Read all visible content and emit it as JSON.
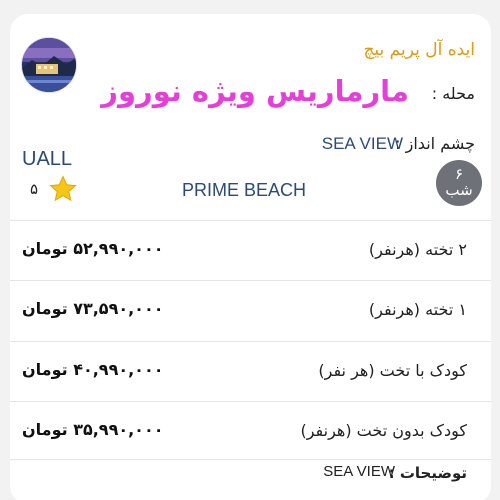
{
  "card": {
    "hotel_name": "ایده آل پریم بیچ",
    "location_label": "محله :",
    "package_name": "مارماریس ویژه نوروز",
    "view_label": "چشم انداز :",
    "view_value": "SEA VIEW",
    "airline": "UALL",
    "rating": "۵",
    "beach": "PRIME BEACH",
    "nights_number": "۶",
    "nights_label": "شب",
    "thumbnail_icon": "hotel-photo-icon",
    "star_icon": "star-icon"
  },
  "prices": [
    {
      "label": "۲ تخته (هرنفر)",
      "price": "۵۲,۹۹۰,۰۰۰ تومان"
    },
    {
      "label": "۱ تخته (هرنفر)",
      "price": "۷۳,۵۹۰,۰۰۰ تومان"
    },
    {
      "label": "کودک با تخت (هر نفر)",
      "price": "۴۰,۹۹۰,۰۰۰ تومان"
    },
    {
      "label": "کودک بدون تخت (هرنفر)",
      "price": "۳۵,۹۹۰,۰۰۰ تومان"
    }
  ],
  "notes": {
    "label": "توضیحات :",
    "value": "SEA VIEW"
  },
  "colors": {
    "hotel_name": "#e09a12",
    "package": "#e63ed8",
    "accent_text": "#2b4a7a",
    "nights_badge": "#6e7278"
  }
}
